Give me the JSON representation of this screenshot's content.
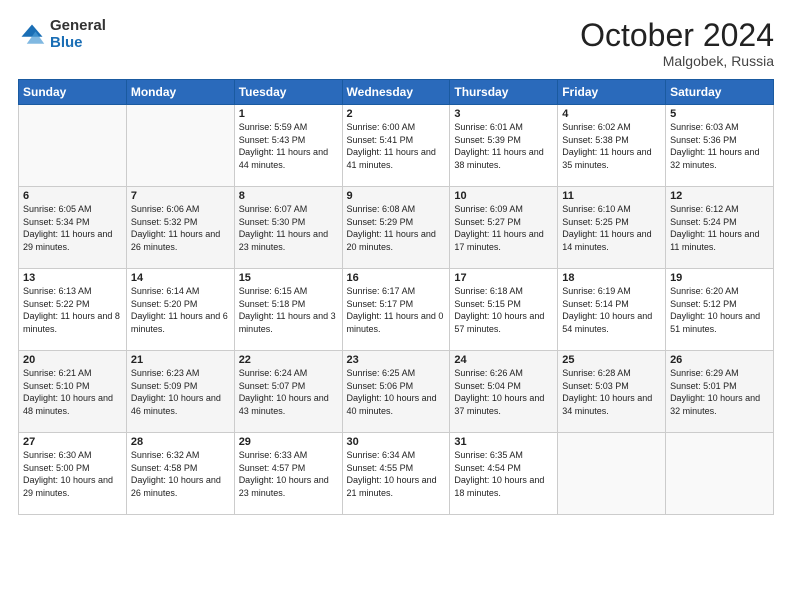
{
  "header": {
    "logo_general": "General",
    "logo_blue": "Blue",
    "month": "October 2024",
    "location": "Malgobek, Russia"
  },
  "weekdays": [
    "Sunday",
    "Monday",
    "Tuesday",
    "Wednesday",
    "Thursday",
    "Friday",
    "Saturday"
  ],
  "weeks": [
    [
      {
        "day": "",
        "info": ""
      },
      {
        "day": "",
        "info": ""
      },
      {
        "day": "1",
        "info": "Sunrise: 5:59 AM\nSunset: 5:43 PM\nDaylight: 11 hours and 44 minutes."
      },
      {
        "day": "2",
        "info": "Sunrise: 6:00 AM\nSunset: 5:41 PM\nDaylight: 11 hours and 41 minutes."
      },
      {
        "day": "3",
        "info": "Sunrise: 6:01 AM\nSunset: 5:39 PM\nDaylight: 11 hours and 38 minutes."
      },
      {
        "day": "4",
        "info": "Sunrise: 6:02 AM\nSunset: 5:38 PM\nDaylight: 11 hours and 35 minutes."
      },
      {
        "day": "5",
        "info": "Sunrise: 6:03 AM\nSunset: 5:36 PM\nDaylight: 11 hours and 32 minutes."
      }
    ],
    [
      {
        "day": "6",
        "info": "Sunrise: 6:05 AM\nSunset: 5:34 PM\nDaylight: 11 hours and 29 minutes."
      },
      {
        "day": "7",
        "info": "Sunrise: 6:06 AM\nSunset: 5:32 PM\nDaylight: 11 hours and 26 minutes."
      },
      {
        "day": "8",
        "info": "Sunrise: 6:07 AM\nSunset: 5:30 PM\nDaylight: 11 hours and 23 minutes."
      },
      {
        "day": "9",
        "info": "Sunrise: 6:08 AM\nSunset: 5:29 PM\nDaylight: 11 hours and 20 minutes."
      },
      {
        "day": "10",
        "info": "Sunrise: 6:09 AM\nSunset: 5:27 PM\nDaylight: 11 hours and 17 minutes."
      },
      {
        "day": "11",
        "info": "Sunrise: 6:10 AM\nSunset: 5:25 PM\nDaylight: 11 hours and 14 minutes."
      },
      {
        "day": "12",
        "info": "Sunrise: 6:12 AM\nSunset: 5:24 PM\nDaylight: 11 hours and 11 minutes."
      }
    ],
    [
      {
        "day": "13",
        "info": "Sunrise: 6:13 AM\nSunset: 5:22 PM\nDaylight: 11 hours and 8 minutes."
      },
      {
        "day": "14",
        "info": "Sunrise: 6:14 AM\nSunset: 5:20 PM\nDaylight: 11 hours and 6 minutes."
      },
      {
        "day": "15",
        "info": "Sunrise: 6:15 AM\nSunset: 5:18 PM\nDaylight: 11 hours and 3 minutes."
      },
      {
        "day": "16",
        "info": "Sunrise: 6:17 AM\nSunset: 5:17 PM\nDaylight: 11 hours and 0 minutes."
      },
      {
        "day": "17",
        "info": "Sunrise: 6:18 AM\nSunset: 5:15 PM\nDaylight: 10 hours and 57 minutes."
      },
      {
        "day": "18",
        "info": "Sunrise: 6:19 AM\nSunset: 5:14 PM\nDaylight: 10 hours and 54 minutes."
      },
      {
        "day": "19",
        "info": "Sunrise: 6:20 AM\nSunset: 5:12 PM\nDaylight: 10 hours and 51 minutes."
      }
    ],
    [
      {
        "day": "20",
        "info": "Sunrise: 6:21 AM\nSunset: 5:10 PM\nDaylight: 10 hours and 48 minutes."
      },
      {
        "day": "21",
        "info": "Sunrise: 6:23 AM\nSunset: 5:09 PM\nDaylight: 10 hours and 46 minutes."
      },
      {
        "day": "22",
        "info": "Sunrise: 6:24 AM\nSunset: 5:07 PM\nDaylight: 10 hours and 43 minutes."
      },
      {
        "day": "23",
        "info": "Sunrise: 6:25 AM\nSunset: 5:06 PM\nDaylight: 10 hours and 40 minutes."
      },
      {
        "day": "24",
        "info": "Sunrise: 6:26 AM\nSunset: 5:04 PM\nDaylight: 10 hours and 37 minutes."
      },
      {
        "day": "25",
        "info": "Sunrise: 6:28 AM\nSunset: 5:03 PM\nDaylight: 10 hours and 34 minutes."
      },
      {
        "day": "26",
        "info": "Sunrise: 6:29 AM\nSunset: 5:01 PM\nDaylight: 10 hours and 32 minutes."
      }
    ],
    [
      {
        "day": "27",
        "info": "Sunrise: 6:30 AM\nSunset: 5:00 PM\nDaylight: 10 hours and 29 minutes."
      },
      {
        "day": "28",
        "info": "Sunrise: 6:32 AM\nSunset: 4:58 PM\nDaylight: 10 hours and 26 minutes."
      },
      {
        "day": "29",
        "info": "Sunrise: 6:33 AM\nSunset: 4:57 PM\nDaylight: 10 hours and 23 minutes."
      },
      {
        "day": "30",
        "info": "Sunrise: 6:34 AM\nSunset: 4:55 PM\nDaylight: 10 hours and 21 minutes."
      },
      {
        "day": "31",
        "info": "Sunrise: 6:35 AM\nSunset: 4:54 PM\nDaylight: 10 hours and 18 minutes."
      },
      {
        "day": "",
        "info": ""
      },
      {
        "day": "",
        "info": ""
      }
    ]
  ]
}
